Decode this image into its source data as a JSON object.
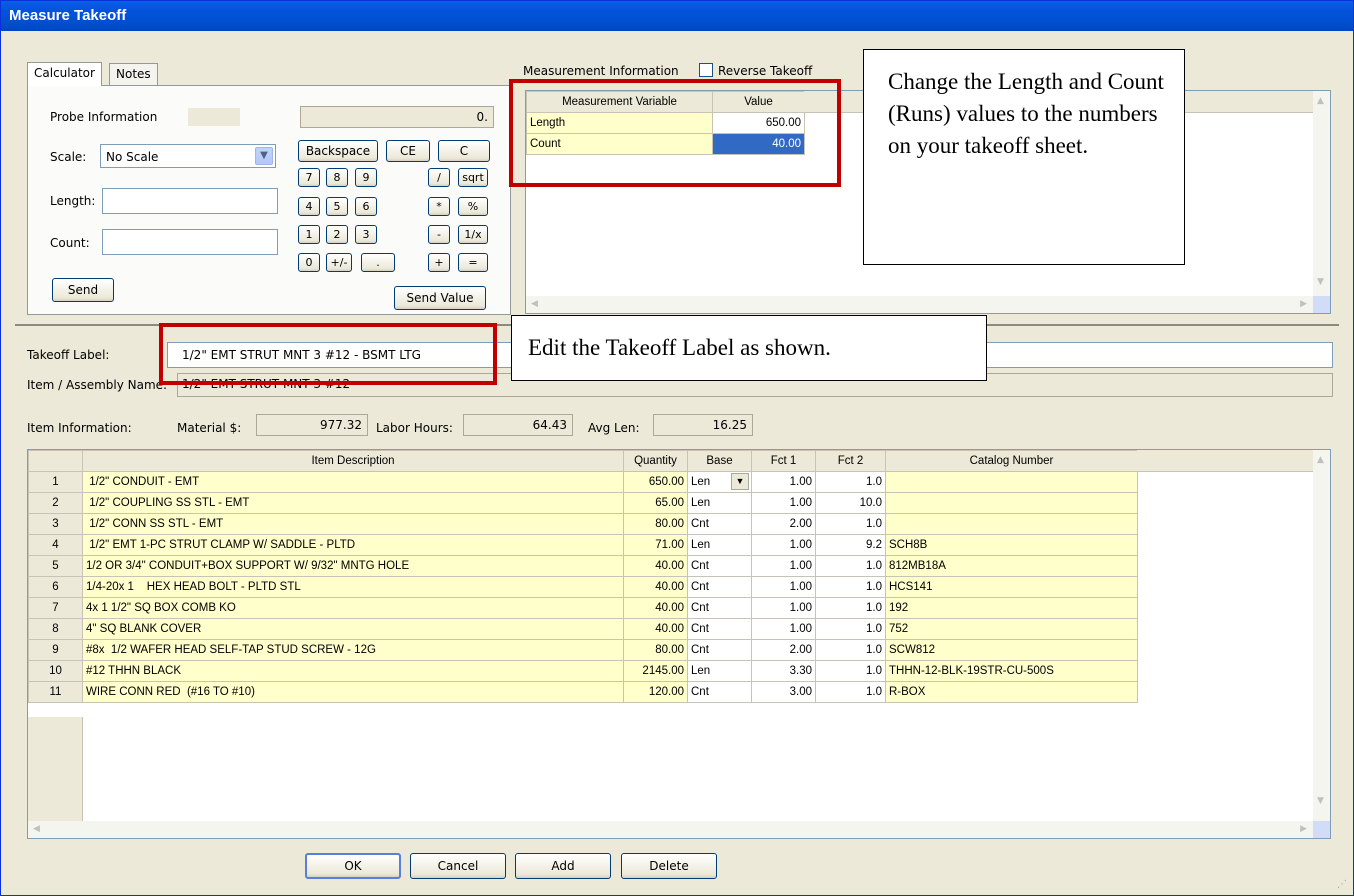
{
  "window": {
    "title": "Measure Takeoff"
  },
  "tabs": [
    {
      "label": "Calculator"
    },
    {
      "label": "Notes"
    }
  ],
  "calculator": {
    "probe_label": "Probe Information",
    "display": "0.",
    "scale_label": "Scale:",
    "scale_value": "No Scale",
    "length_label": "Length:",
    "count_label": "Count:",
    "send_label": "Send",
    "send_value_label": "Send Value",
    "keys": {
      "backspace": "Backspace",
      "ce": "CE",
      "c": "C",
      "k7": "7",
      "k8": "8",
      "k9": "9",
      "div": "/",
      "sqrt": "sqrt",
      "k4": "4",
      "k5": "5",
      "k6": "6",
      "mul": "*",
      "pct": "%",
      "k1": "1",
      "k2": "2",
      "k3": "3",
      "sub": "-",
      "inv": "1/x",
      "k0": "0",
      "neg": "+/-",
      "dot": ".",
      "add": "+",
      "eq": "="
    }
  },
  "measurement": {
    "section_label": "Measurement Information",
    "reverse_label": "Reverse Takeoff",
    "headers": {
      "variable": "Measurement Variable",
      "value": "Value"
    },
    "rows": [
      {
        "variable": "Length",
        "value": "650.00"
      },
      {
        "variable": "Count",
        "value": "40.00"
      }
    ]
  },
  "takeoff": {
    "label_caption": "Takeoff Label:",
    "label_value": "1/2\" EMT STRUT MNT  3 #12 - BSMT LTG",
    "assembly_caption": "Item / Assembly Name:",
    "assembly_value": "1/2\" EMT STRUT MNT  3 #12"
  },
  "item_info": {
    "caption": "Item Information:",
    "material_label": "Material $:",
    "material_value": "977.32",
    "labor_label": "Labor Hours:",
    "labor_value": "64.43",
    "avglen_label": "Avg Len:",
    "avglen_value": "16.25"
  },
  "items": {
    "headers": {
      "desc": "Item Description",
      "qty": "Quantity",
      "base": "Base",
      "f1": "Fct 1",
      "f2": "Fct 2",
      "cat": "Catalog Number"
    },
    "rows": [
      {
        "n": "1",
        "desc": " 1/2\" CONDUIT - EMT",
        "qty": "650.00",
        "base": "Len",
        "f1": "1.00",
        "f2": "1.0",
        "cat": ""
      },
      {
        "n": "2",
        "desc": " 1/2\" COUPLING SS STL - EMT",
        "qty": "65.00",
        "base": "Len",
        "f1": "1.00",
        "f2": "10.0",
        "cat": ""
      },
      {
        "n": "3",
        "desc": " 1/2\" CONN SS STL - EMT",
        "qty": "80.00",
        "base": "Cnt",
        "f1": "2.00",
        "f2": "1.0",
        "cat": ""
      },
      {
        "n": "4",
        "desc": " 1/2\" EMT 1-PC STRUT CLAMP W/ SADDLE - PLTD",
        "qty": "71.00",
        "base": "Len",
        "f1": "1.00",
        "f2": "9.2",
        "cat": "SCH8B"
      },
      {
        "n": "5",
        "desc": "1/2 OR 3/4\" CONDUIT+BOX SUPPORT W/ 9/32\" MNTG HOLE",
        "qty": "40.00",
        "base": "Cnt",
        "f1": "1.00",
        "f2": "1.0",
        "cat": "812MB18A"
      },
      {
        "n": "6",
        "desc": "1/4-20x 1    HEX HEAD BOLT - PLTD STL",
        "qty": "40.00",
        "base": "Cnt",
        "f1": "1.00",
        "f2": "1.0",
        "cat": "HCS141"
      },
      {
        "n": "7",
        "desc": "4x 1 1/2\" SQ BOX COMB KO",
        "qty": "40.00",
        "base": "Cnt",
        "f1": "1.00",
        "f2": "1.0",
        "cat": "192"
      },
      {
        "n": "8",
        "desc": "4\" SQ BLANK COVER",
        "qty": "40.00",
        "base": "Cnt",
        "f1": "1.00",
        "f2": "1.0",
        "cat": "752"
      },
      {
        "n": "9",
        "desc": "#8x  1/2 WAFER HEAD SELF-TAP STUD SCREW - 12G",
        "qty": "80.00",
        "base": "Cnt",
        "f1": "2.00",
        "f2": "1.0",
        "cat": "SCW812"
      },
      {
        "n": "10",
        "desc": "#12 THHN BLACK",
        "qty": "2145.00",
        "base": "Len",
        "f1": "3.30",
        "f2": "1.0",
        "cat": "THHN-12-BLK-19STR-CU-500S"
      },
      {
        "n": "11",
        "desc": "WIRE CONN RED  (#16 TO #10)",
        "qty": "120.00",
        "base": "Cnt",
        "f1": "3.00",
        "f2": "1.0",
        "cat": "R-BOX"
      }
    ]
  },
  "buttons": {
    "ok": "OK",
    "cancel": "Cancel",
    "add": "Add",
    "delete": "Delete"
  },
  "annotations": {
    "callout_measure": "Change the Length and Count (Runs) values to the numbers on your takeoff sheet.",
    "callout_label": "Edit the Takeoff Label as shown."
  },
  "icons": {
    "dropdown": "chevron-down-icon",
    "scroll_up": "scroll-up-icon",
    "scroll_down": "scroll-down-icon"
  },
  "colors": {
    "titlebar": "#0453db",
    "highlight_row": "#ffffcc",
    "selection": "#316ac5",
    "annotation_border": "#c00000"
  }
}
